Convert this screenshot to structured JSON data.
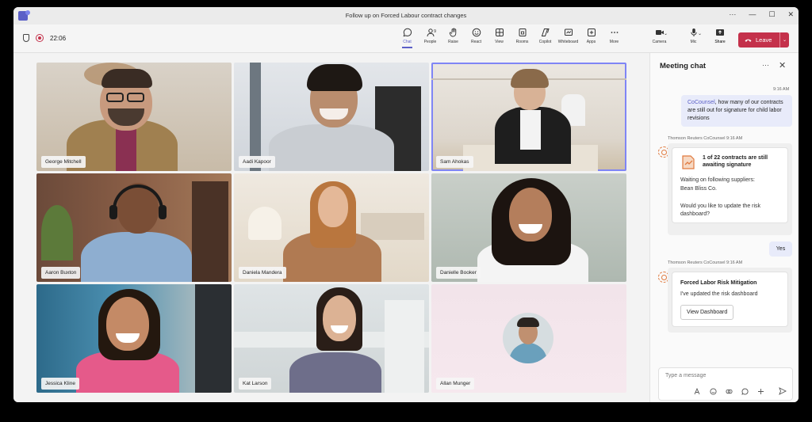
{
  "window": {
    "title": "Follow up on Forced Labour contract changes"
  },
  "window_controls": {
    "more": "···",
    "minimize": "—",
    "maximize": "☐",
    "close": "✕"
  },
  "toolbar": {
    "timer": "22:06",
    "items": [
      {
        "label": "Chat",
        "icon": "chat-icon"
      },
      {
        "label": "People",
        "icon": "people-icon",
        "badge": "9"
      },
      {
        "label": "Raise",
        "icon": "hand-icon"
      },
      {
        "label": "React",
        "icon": "smile-icon"
      },
      {
        "label": "View",
        "icon": "grid-icon"
      },
      {
        "label": "Rooms",
        "icon": "rooms-icon"
      },
      {
        "label": "Copilot",
        "icon": "copilot-icon"
      },
      {
        "label": "Whiteboard",
        "icon": "whiteboard-icon"
      },
      {
        "label": "Apps",
        "icon": "plus-square-icon"
      },
      {
        "label": "More",
        "icon": "more-icon"
      }
    ],
    "camera_label": "Camera",
    "mic_label": "Mic",
    "share_label": "Share",
    "leave_label": "Leave"
  },
  "participants": [
    {
      "name": "George Mitchell"
    },
    {
      "name": "Aadi Kapoor"
    },
    {
      "name": "Sam Ahokas"
    },
    {
      "name": "Aaron Buxton"
    },
    {
      "name": "Daniela Mandera"
    },
    {
      "name": "Danielle Booker"
    },
    {
      "name": "Jessica Kline"
    },
    {
      "name": "Kat Larson"
    },
    {
      "name": "Allan Munger"
    }
  ],
  "chat": {
    "title": "Meeting chat",
    "msg1_time": "9:16 AM",
    "msg1_mention": "CoCounsel",
    "msg1_text": ", how many of our contracts are still out for signature for child labor revisions",
    "bot1_header": "Thomson Reuters CoCounsel   9:16 AM",
    "bot1_title": "1 of 22 contracts are still awaiting signature",
    "bot1_line1": "Waiting on following suppliers:",
    "bot1_line2": "Bean Bliss Co.",
    "bot1_line3": "Would you like to update the risk dashboard?",
    "reply_time": "9:16 AM",
    "reply": "Yes",
    "bot2_header": "Thomson Reuters CoCounsel   9:16 AM",
    "bot2_title": "Forced Labor Risk Mitigation",
    "bot2_text": "I've updated the risk dashboard",
    "bot2_button": "View Dashboard",
    "composer_placeholder": "Type a message"
  },
  "colors": {
    "accent": "#5b5fc7",
    "leave": "#c4314b",
    "bot": "#e07a3f"
  }
}
